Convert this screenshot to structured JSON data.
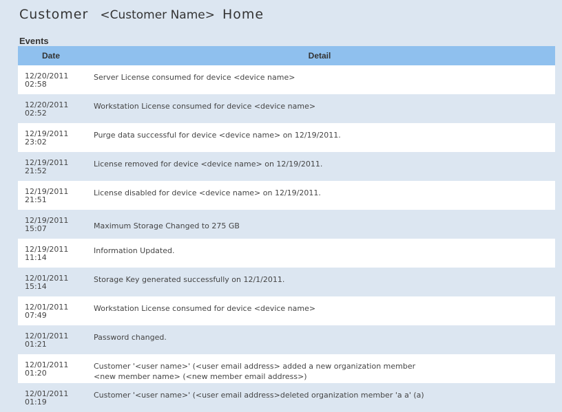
{
  "page": {
    "title_word": "Customer",
    "title_name": "<Customer Name>",
    "title_home": "Home",
    "section": "Events"
  },
  "table": {
    "headers": [
      "Date",
      "Detail"
    ],
    "rows": [
      {
        "date": "12/20/2011",
        "time": "02:58",
        "detail": "Server License consumed for device <device name>",
        "detail2": ""
      },
      {
        "date": "12/20/2011",
        "time": "02:52",
        "detail": "Workstation License consumed for device <device name>",
        "detail2": ""
      },
      {
        "date": "12/19/2011",
        "time": "23:02",
        "detail": "Purge data successful for device <device name> on 12/19/2011.",
        "detail2": ""
      },
      {
        "date": "12/19/2011",
        "time": "21:52",
        "detail": "License removed for device <device name> on 12/19/2011.",
        "detail2": ""
      },
      {
        "date": "12/19/2011",
        "time": "21:51",
        "detail": "License disabled for device <device name> on 12/19/2011.",
        "detail2": ""
      },
      {
        "date": "12/19/2011",
        "time": "15:07",
        "detail": "Maximum Storage Changed to 275 GB",
        "detail2": ""
      },
      {
        "date": "12/19/2011",
        "time": "11:14",
        "detail": "Information Updated.",
        "detail2": ""
      },
      {
        "date": "12/01/2011",
        "time": "15:14",
        "detail": "Storage Key generated successfully on 12/1/2011.",
        "detail2": ""
      },
      {
        "date": "12/01/2011",
        "time": "07:49",
        "detail": "Workstation License consumed for device <device name>",
        "detail2": ""
      },
      {
        "date": "12/01/2011",
        "time": "01:21",
        "detail": "Password changed.",
        "detail2": ""
      },
      {
        "date": "12/01/2011",
        "time": "01:20",
        "detail": "Customer '<user name>' (<user email address> added a new organization member",
        "detail2": "<new member name> (<new member email address>)"
      },
      {
        "date": "12/01/2011",
        "time": "01:19",
        "detail": "Customer '<user name>' (<user email address>deleted organization member 'a a' (a)",
        "detail2": ""
      }
    ]
  },
  "colors": {
    "background": "#dce6f1",
    "header": "#8fc0ee",
    "row_white": "#ffffff"
  }
}
